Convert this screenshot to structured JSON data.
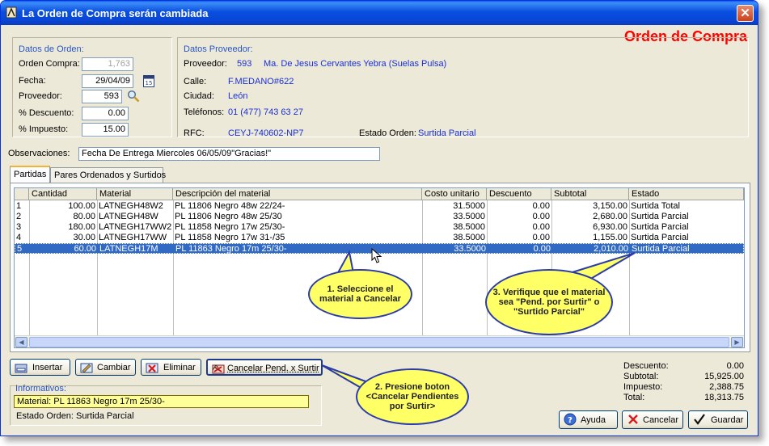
{
  "window": {
    "title": "La Orden de Compra  serán cambiada",
    "close": "✕",
    "header": "Orden de Compra"
  },
  "orden": {
    "section": "Datos de Orden:",
    "orden_compra_label": "Orden Compra:",
    "orden_compra": "1,763",
    "fecha_label": "Fecha:",
    "fecha": "29/04/09",
    "proveedor_label": "Proveedor:",
    "proveedor": "593",
    "descuento_label": "% Descuento:",
    "descuento": "0.00",
    "impuesto_label": "% Impuesto:",
    "impuesto": "15.00"
  },
  "proveedor": {
    "section": "Datos Proveedor:",
    "proveedor_label": "Proveedor:",
    "proveedor_id": "593",
    "proveedor_nombre": "Ma. De Jesus Cervantes Yebra (Suelas Pulsa)",
    "calle_label": "Calle:",
    "calle": "F.MEDANO#622",
    "ciudad_label": "Ciudad:",
    "ciudad": "León",
    "telefonos_label": "Teléfonos:",
    "telefonos": "01 (477) 743 63 27",
    "rfc_label": "RFC:",
    "rfc": "CEYJ-740602-NP7",
    "estado_label": "Estado Orden:",
    "estado": "Surtida Parcial"
  },
  "observaciones": {
    "label": "Observaciones:",
    "value": "Fecha De Entrega Miercoles 06/05/09\"Gracias!\""
  },
  "tabs": [
    "Partidas",
    "Pares Ordenados y Surtidos"
  ],
  "grid": {
    "headers": [
      "Cantidad",
      "Material",
      "Descripción del material",
      "Costo unitario",
      "Descuento",
      "Subtotal",
      "Estado"
    ],
    "rows": [
      {
        "n": "1",
        "cantidad": "100.00",
        "material": "LATNEGH48W2",
        "descripcion": "PL 11806 Negro 48w 22/24-",
        "costo": "31.5000",
        "descuento": "0.00",
        "subtotal": "3,150.00",
        "estado": "Surtida Total"
      },
      {
        "n": "2",
        "cantidad": "80.00",
        "material": "LATNEGH48W",
        "descripcion": "PL 11806 Negro 48w 25/30",
        "costo": "33.5000",
        "descuento": "0.00",
        "subtotal": "2,680.00",
        "estado": "Surtida Parcial"
      },
      {
        "n": "3",
        "cantidad": "180.00",
        "material": "LATNEGH17WW2",
        "descripcion": "PL 11858 Negro 17w 25/30-",
        "costo": "38.5000",
        "descuento": "0.00",
        "subtotal": "6,930.00",
        "estado": "Surtida Parcial"
      },
      {
        "n": "4",
        "cantidad": "30.00",
        "material": "LATNEGH17WW",
        "descripcion": "PL 11858 Negro 17w 31-/35",
        "costo": "38.5000",
        "descuento": "0.00",
        "subtotal": "1,155.00",
        "estado": "Surtida Parcial"
      },
      {
        "n": "5",
        "cantidad": "60.00",
        "material": "LATNEGH17M",
        "descripcion": "PL 11863 Negro 17m 25/30-",
        "costo": "33.5000",
        "descuento": "0.00",
        "subtotal": "2,010.00",
        "estado": "Surtida Parcial"
      }
    ]
  },
  "buttons": {
    "insertar": "Insertar",
    "cambiar": "Cambiar",
    "eliminar": "Eliminar",
    "cancelar_pend": "Cancelar Pend. x Surtir",
    "ayuda": "Ayuda",
    "cancelar": "Cancelar",
    "guardar": "Guardar"
  },
  "informativos": {
    "label": "Informativos:",
    "material": "Material: PL 11863 Negro 17m 25/30-",
    "estado": "Estado Orden: Surtida Parcial"
  },
  "totales": {
    "descuento_label": "Descuento:",
    "descuento": "0.00",
    "subtotal_label": "Subtotal:",
    "subtotal": "15,925.00",
    "impuesto_label": "Impuesto:",
    "impuesto": "2,388.75",
    "total_label": "Total:",
    "total": "18,313.75"
  },
  "callouts": {
    "c1": "1. Seleccione el material a Cancelar",
    "c2": "2. Presione boton <Cancelar Pendientes por Surtir>",
    "c3": "3. Verifique que el material sea \"Pend. por Surtir\" o \"Surtido Parcial\""
  },
  "colors": {
    "accent_red": "#ff0000",
    "selection": "#316ac5",
    "callout_fill": "#ffff66"
  }
}
